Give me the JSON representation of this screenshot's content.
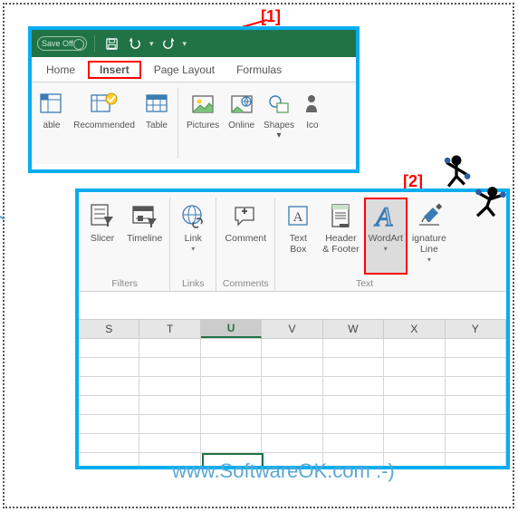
{
  "callouts": {
    "one": "[1]",
    "two": "[2]"
  },
  "watermark": "www.SoftwareOK.com :-)",
  "panel1": {
    "autosave_prefix": "Save",
    "autosave_state": "Off",
    "tabs": {
      "home": "Home",
      "insert": "Insert",
      "page_layout": "Page Layout",
      "formulas": "Formulas"
    },
    "buttons": {
      "able": "able",
      "recommended": "Recommended",
      "table": "Table",
      "pictures": "Pictures",
      "online": "Online",
      "shapes": "Shapes",
      "ico": "Ico"
    }
  },
  "panel2": {
    "buttons": {
      "slicer": "Slicer",
      "timeline": "Timeline",
      "link": "Link",
      "comment": "Comment",
      "textbox": "Text\nBox",
      "headerfooter": "Header\n& Footer",
      "wordart": "WordArt",
      "sigline": "ignature\nLine"
    },
    "groups": {
      "filters": "Filters",
      "links": "Links",
      "comments": "Comments",
      "text": "Text"
    },
    "cols": [
      "S",
      "T",
      "U",
      "V",
      "W",
      "X",
      "Y"
    ]
  }
}
